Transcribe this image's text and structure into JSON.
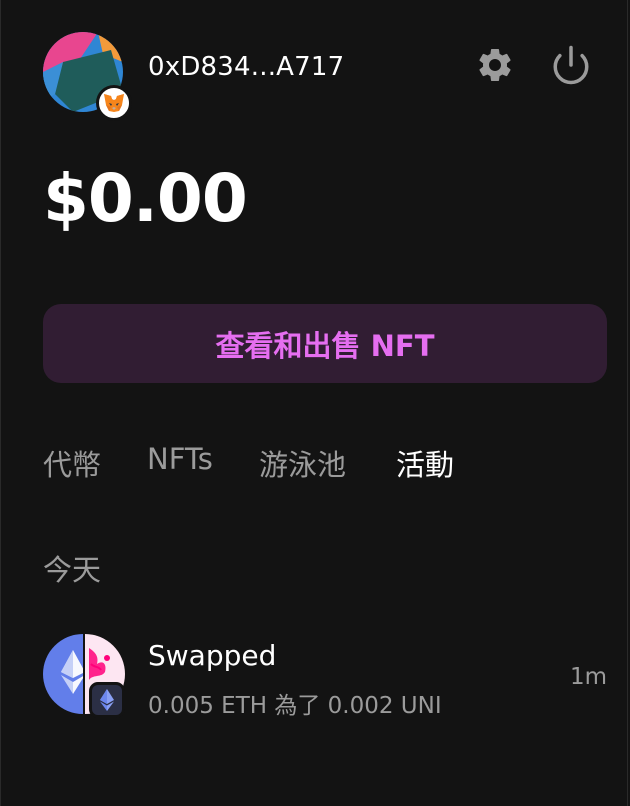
{
  "header": {
    "address": "0xD834...A717",
    "wallet_badge_icon": "metamask-fox-icon",
    "settings_icon": "gear-icon",
    "power_icon": "power-icon"
  },
  "portfolio": {
    "balance": "$0.00"
  },
  "nft_button": {
    "label": "查看和出售 NFT",
    "color": "#e56ef0",
    "background": "#311d33"
  },
  "tabs": [
    {
      "label": "代幣",
      "active": false
    },
    {
      "label": "NFTs",
      "active": false
    },
    {
      "label": "游泳池",
      "active": false
    },
    {
      "label": "活動",
      "active": true
    }
  ],
  "activity": {
    "section_label": "今天",
    "items": [
      {
        "title": "Swapped",
        "description": "0.005 ETH 為了 0.002 UNI",
        "time": "1m",
        "token_in_icon": "eth-icon",
        "token_out_icon": "uni-icon",
        "chain_icon": "ethereum-chain-icon"
      }
    ]
  },
  "colors": {
    "background": "#131313",
    "text_primary": "#ffffff",
    "text_secondary": "#9b9b9b",
    "eth_blue": "#627eea",
    "uni_pink": "#ff007a"
  }
}
